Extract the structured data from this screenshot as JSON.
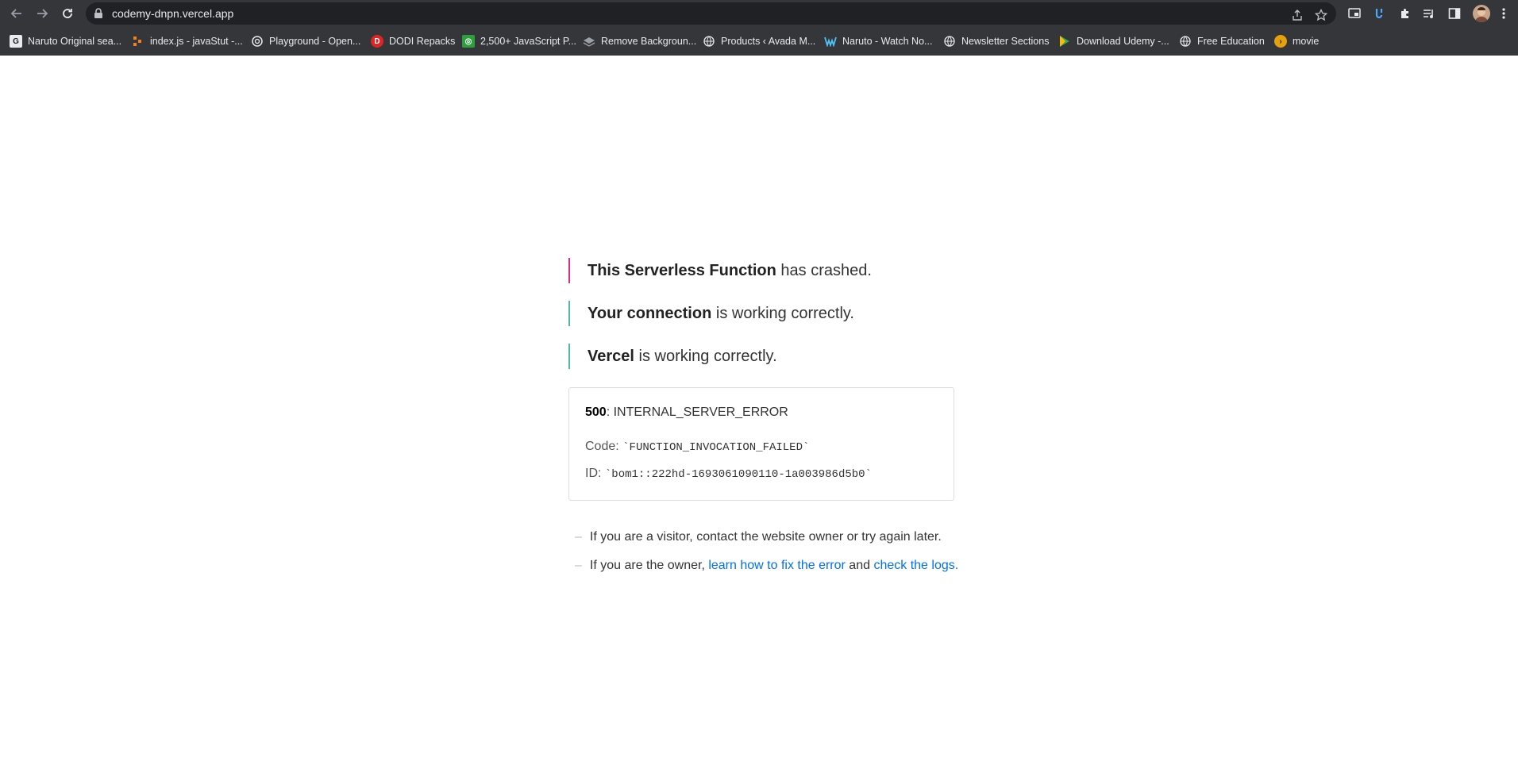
{
  "browser": {
    "url": "codemy-dnpn.vercel.app",
    "bookmarks": [
      {
        "label": "Naruto Original sea...",
        "icon": "letterbox-icon"
      },
      {
        "label": "index.js - javaStut -...",
        "icon": "dots-icon"
      },
      {
        "label": "Playground - Open...",
        "icon": "openai-icon"
      },
      {
        "label": "DODI Repacks",
        "icon": "dodi-icon"
      },
      {
        "label": "2,500+ JavaScript P...",
        "icon": "green-badge-icon"
      },
      {
        "label": "Remove Backgroun...",
        "icon": "layers-icon"
      },
      {
        "label": "Products ‹ Avada M...",
        "icon": "globe-icon"
      },
      {
        "label": "Naruto - Watch No...",
        "icon": "crunchy-icon"
      },
      {
        "label": "Newsletter Sections",
        "icon": "globe-icon"
      },
      {
        "label": "Download Udemy -...",
        "icon": "play-icon"
      },
      {
        "label": "Free Education",
        "icon": "globe-icon"
      },
      {
        "label": "movie",
        "icon": "plex-icon"
      }
    ]
  },
  "error_page": {
    "messages": [
      {
        "bold": "This Serverless Function",
        "rest": " has crashed.",
        "color": "#d92d8a"
      },
      {
        "bold": "Your connection",
        "rest": " is working correctly.",
        "color": "#50b8a8"
      },
      {
        "bold": "Vercel",
        "rest": " is working correctly.",
        "color": "#50b8a8"
      }
    ],
    "status_code": "500",
    "status_text": ": INTERNAL_SERVER_ERROR",
    "code_label": "Code: ",
    "code_value": "`FUNCTION_INVOCATION_FAILED`",
    "id_label": "ID: ",
    "id_value": "`bom1::222hd-1693061090110-1a003986d5b0`",
    "help_visitor": "If you are a visitor, contact the website owner or try again later.",
    "help_owner_prefix": "If you are the owner, ",
    "help_owner_link1": "learn how to fix the error",
    "help_owner_mid": " and ",
    "help_owner_link2": "check the logs."
  }
}
